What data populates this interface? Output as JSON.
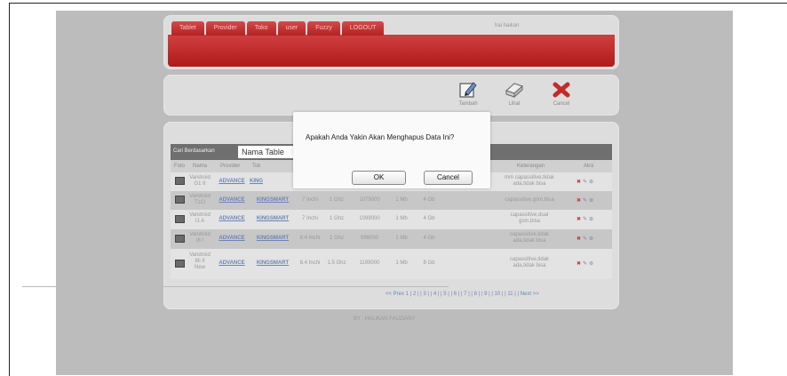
{
  "nav": {
    "tabs": [
      "Tablet",
      "Provider",
      "Toko",
      "user",
      "Fuzzy",
      "LOGOUT"
    ],
    "greeting": "hai haikan"
  },
  "actions": {
    "add": "Tambah",
    "view": "Lihat",
    "cancel": "Cancel"
  },
  "search": {
    "label": "Cari Berdasarkan",
    "selected": "Nama Table"
  },
  "table": {
    "columns": [
      "Foto",
      "Nama",
      "Provider",
      "Tok",
      "Keterangan",
      "Aksi"
    ],
    "rows": [
      {
        "nama": [
          "Vandroid",
          "G1 II"
        ],
        "provider": "ADVANCE",
        "toko": "KING",
        "lcd": "",
        "proc": "",
        "harga": "",
        "ram": "",
        "rom": "",
        "ket": [
          "mm capassitive,tidak",
          "ada,tidak bisa"
        ]
      },
      {
        "nama": [
          "Vandroid",
          "T1Ci"
        ],
        "provider": "ADVANCE",
        "toko": "KINGSMART",
        "lcd": "7 Inchi",
        "proc": "1 Ghz",
        "harga": "1075000",
        "ram": "1 Mb",
        "rom": "4 Gb",
        "ket": [
          "capassitive,gsm,bisa"
        ]
      },
      {
        "nama": [
          "Vandroid",
          "I1 A"
        ],
        "provider": "ADVANCE",
        "toko": "KINGSMART",
        "lcd": "7 Inchi",
        "proc": "1 Ghz",
        "harga": "1099000",
        "ram": "1 Mb",
        "rom": "4 Gb",
        "ket": [
          "capassitive,dual",
          "gsm,bisa"
        ]
      },
      {
        "nama": [
          "Vandroid",
          "I8 I"
        ],
        "provider": "ADVANCE",
        "toko": "KINGSMART",
        "lcd": "8.4 Inchi",
        "proc": "1 Ghz",
        "harga": "999000",
        "ram": "1 Mb",
        "rom": "4 Gb",
        "ket": [
          "capassitive,tidak",
          "ada,tidak bisa"
        ]
      },
      {
        "nama": [
          "Vandroid",
          "I8i II",
          "New"
        ],
        "provider": "ADVANCE",
        "toko": "KINGSMART",
        "lcd": "8.4 Inchi",
        "proc": "1.5 Ghz",
        "harga": "1199000",
        "ram": "1 Mb",
        "rom": "8 Gb",
        "ket": [
          "capassitive,tidak",
          "ada,tidak bisa"
        ]
      }
    ]
  },
  "pagination": {
    "text": "<< Prev 1 | 2 | | 3 | | 4 | | 5 | | 6 | | 7 | | 8 | | 9 | | 10 | | 11 | | Next >>"
  },
  "footer": "BY : HALIKAN FAUZIANY",
  "dialog": {
    "message": "Apakah Anda Yakin Akan Menghapus Data Ini?",
    "ok": "OK",
    "cancel": "Cancel"
  }
}
